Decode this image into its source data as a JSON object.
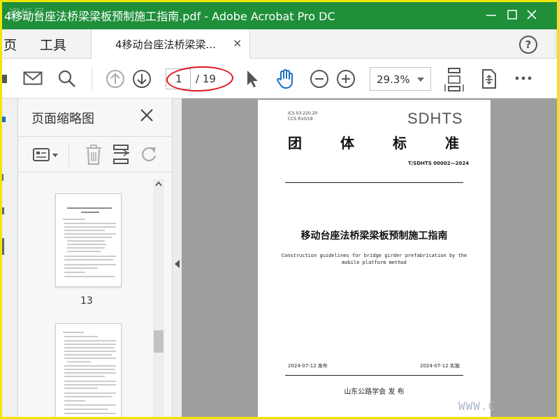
{
  "window": {
    "title": "4移动台座法桥梁梁板预制施工指南.pdf - Adobe Acrobat Pro DC",
    "watermark": "瓷板号",
    "minimize_icon": "minimize-icon",
    "maximize_icon": "maximize-icon",
    "close_icon": "close-icon"
  },
  "menu": {
    "home": "页",
    "tools": "工具"
  },
  "tab": {
    "label": "4移动台座法桥梁梁...",
    "close": "×"
  },
  "help": {
    "label": "?"
  },
  "toolbar": {
    "icons": [
      "print-icon",
      "email-icon",
      "search-icon",
      "prev-page-icon",
      "next-page-icon",
      "select-cursor-icon",
      "hand-tool-icon",
      "zoom-out-icon",
      "zoom-in-icon",
      "fit-page-icon",
      "rotate-view-icon",
      "more-icon"
    ],
    "page_current": "1",
    "page_total": "/ 19",
    "zoom": "29.3%"
  },
  "panel": {
    "title": "页面缩略图",
    "close": "×",
    "tool_icons": [
      "thumbnail-options-icon",
      "delete-page-icon",
      "extract-page-icon",
      "rotate-page-icon"
    ],
    "thumbnail_label": "13"
  },
  "document": {
    "ics": "ICS 03.220.20",
    "ccs": "CCS R10/19",
    "brand": "SDHTS",
    "std_chars": [
      "团",
      "体",
      "标",
      "准"
    ],
    "code": "T/SDHTS 00002—2024",
    "title_cn": "移动台座法桥梁梁板预制施工指南",
    "title_en_line1": "Construction guidelines for bridge girder prefabrication by the",
    "title_en_line2": "mobile platform method",
    "issue_date": "2024-07-12 发布",
    "impl_date": "2024-07-12 实施",
    "publisher": "山东公路学会   发 布"
  },
  "watermark_url": "WWW.C",
  "colors": {
    "titlebar": "#1f8f3a",
    "frame": "#f2e600",
    "annotation": "#e0141e",
    "hand_tool": "#1a6fc4"
  }
}
